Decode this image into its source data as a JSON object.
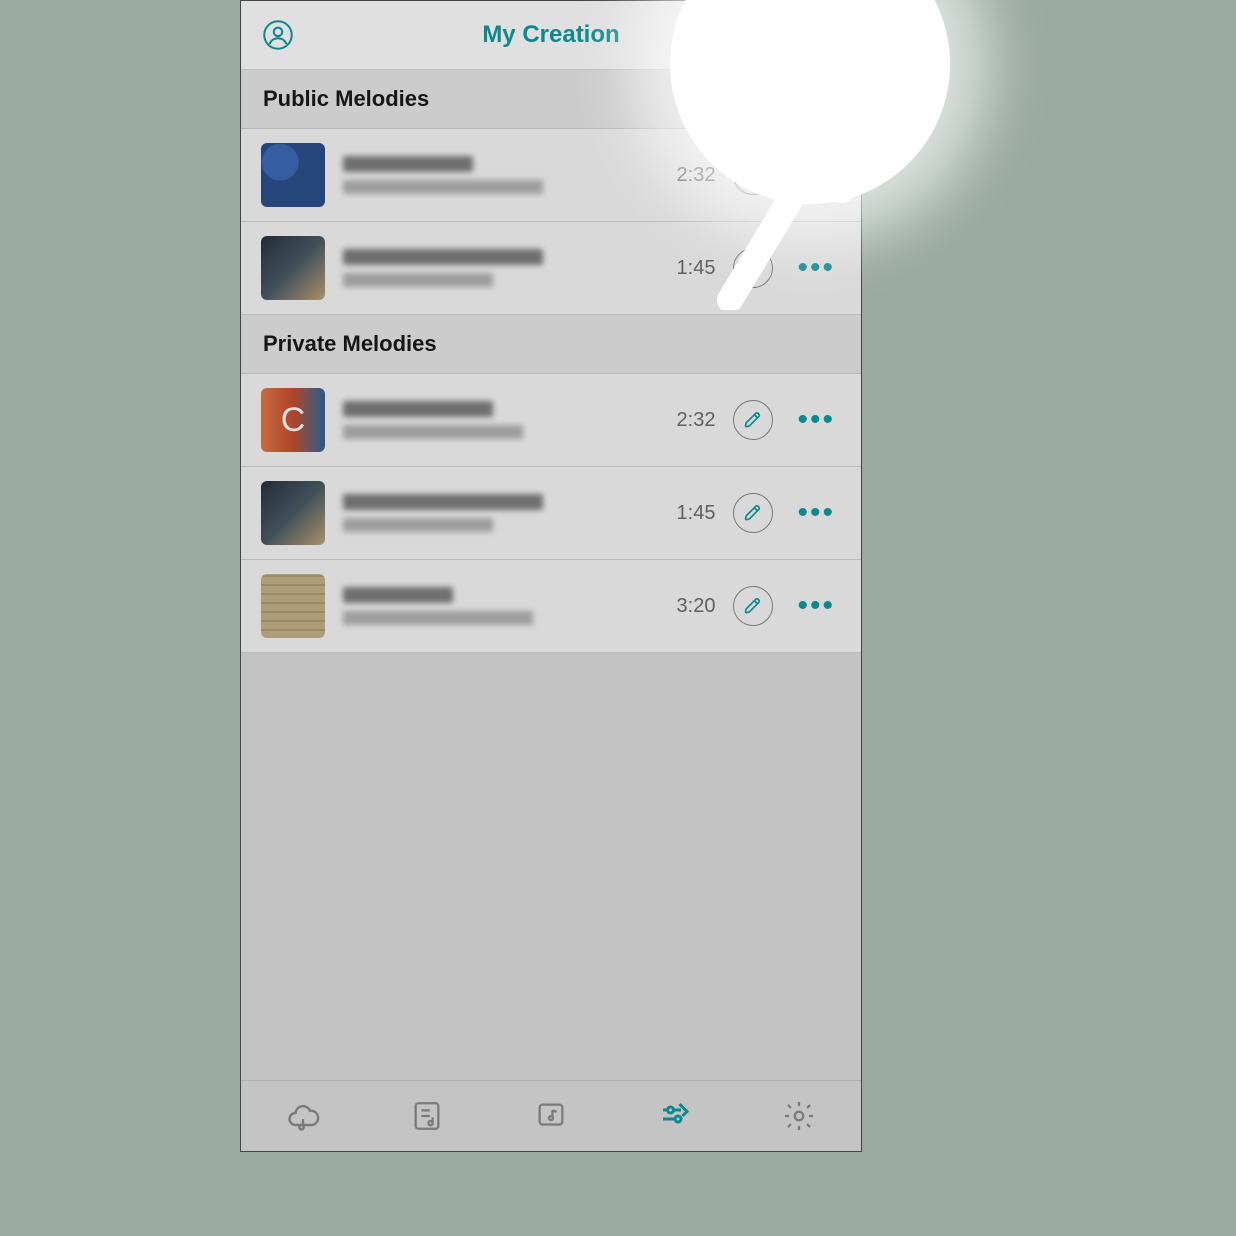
{
  "colors": {
    "accent": "#0e9ba3",
    "mutedText": "#6d6d6d"
  },
  "nav": {
    "title": "My Creation",
    "profileIcon": "profile-icon",
    "addIcon": "plus-icon"
  },
  "sections": [
    {
      "title": "Public Melodies",
      "items": [
        {
          "thumbStyle": "sunflower",
          "letter": "",
          "titleBlurWidth": 130,
          "subBlurWidth": 200,
          "duration": "2:32"
        },
        {
          "thumbStyle": "guitar",
          "letter": "",
          "titleBlurWidth": 200,
          "subBlurWidth": 150,
          "duration": "1:45"
        }
      ]
    },
    {
      "title": "Private Melodies",
      "items": [
        {
          "thumbStyle": "letter",
          "letter": "C",
          "titleBlurWidth": 150,
          "subBlurWidth": 180,
          "duration": "2:32"
        },
        {
          "thumbStyle": "guitar",
          "letter": "",
          "titleBlurWidth": 200,
          "subBlurWidth": 150,
          "duration": "1:45"
        },
        {
          "thumbStyle": "sheet",
          "letter": "",
          "titleBlurWidth": 110,
          "subBlurWidth": 190,
          "duration": "3:20"
        }
      ]
    }
  ],
  "tabs": [
    {
      "name": "cloud-music-icon",
      "active": false
    },
    {
      "name": "playlist-icon",
      "active": false
    },
    {
      "name": "note-card-icon",
      "active": false
    },
    {
      "name": "editor-icon",
      "active": true
    },
    {
      "name": "settings-icon",
      "active": false
    }
  ],
  "hint": {
    "highlightTarget": "add-button",
    "arrow": true
  }
}
